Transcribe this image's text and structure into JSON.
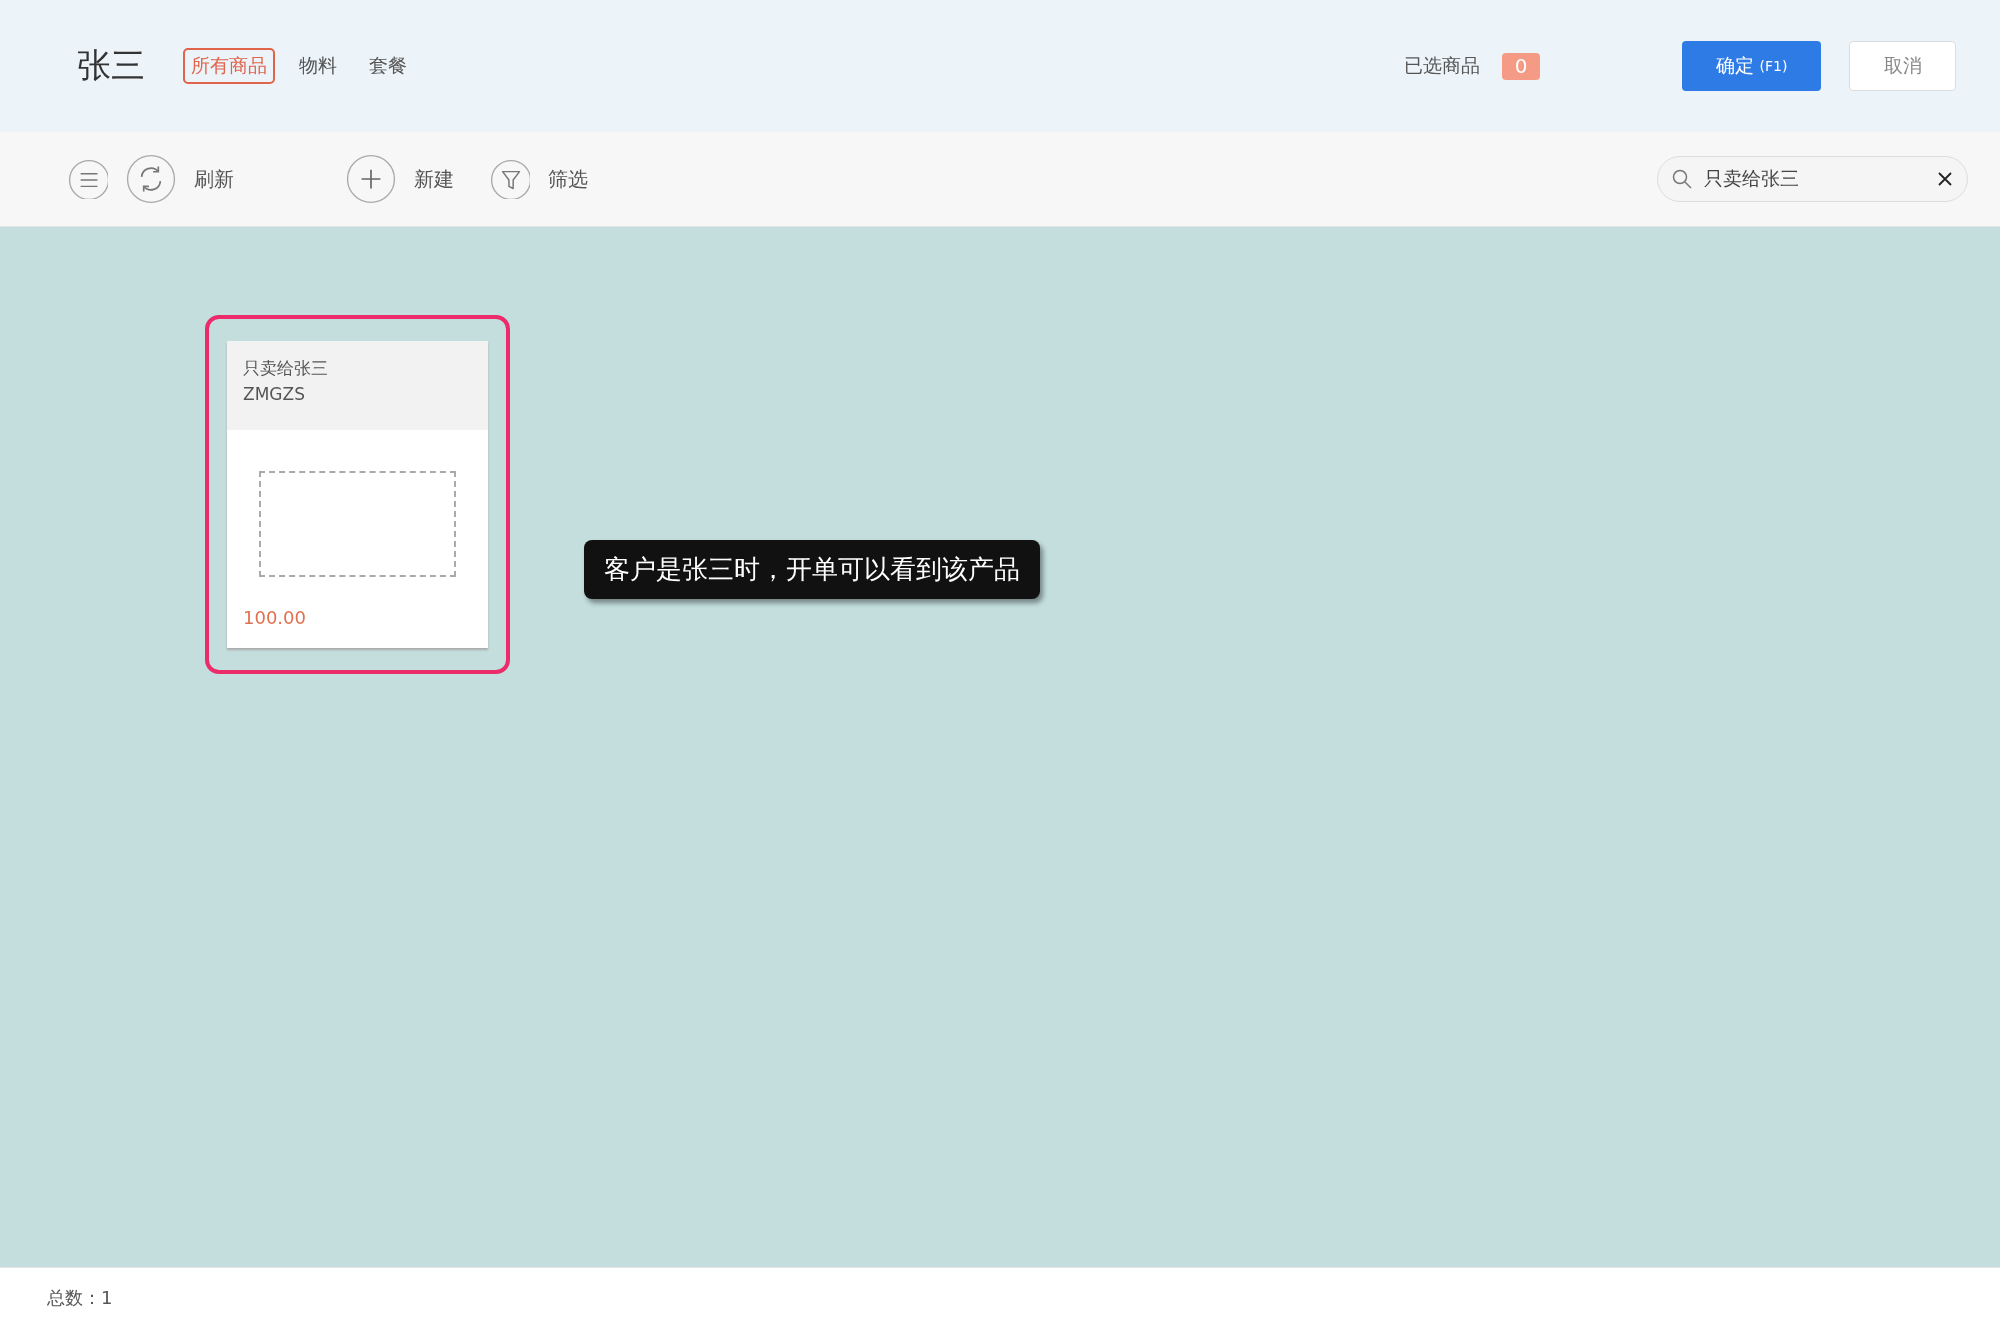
{
  "header": {
    "title": "张三",
    "tabs": [
      {
        "label": "所有商品",
        "selected": true
      },
      {
        "label": "物料",
        "selected": false
      },
      {
        "label": "套餐",
        "selected": false
      }
    ],
    "selected_label": "已选商品",
    "selected_count": "0",
    "buttons": [
      {
        "label": "确定",
        "shortcut": "(F1)",
        "kind": "primary"
      },
      {
        "label": "取消",
        "kind": "secondary"
      }
    ]
  },
  "toolbar": {
    "items": [
      {
        "kind": "menu"
      },
      {
        "kind": "refresh",
        "label": "刷新"
      },
      {
        "kind": "new",
        "label": "新建"
      },
      {
        "kind": "filter",
        "label": "筛选"
      }
    ],
    "search": {
      "value": "只卖给张三"
    }
  },
  "products": [
    {
      "name": "只卖给张三",
      "code": "ZMGZS",
      "price": "100.00",
      "highlighted": true
    }
  ],
  "annotation": {
    "text": "客户是张三时，开单可以看到该产品"
  },
  "status_bar": {
    "total": "总数：1"
  }
}
